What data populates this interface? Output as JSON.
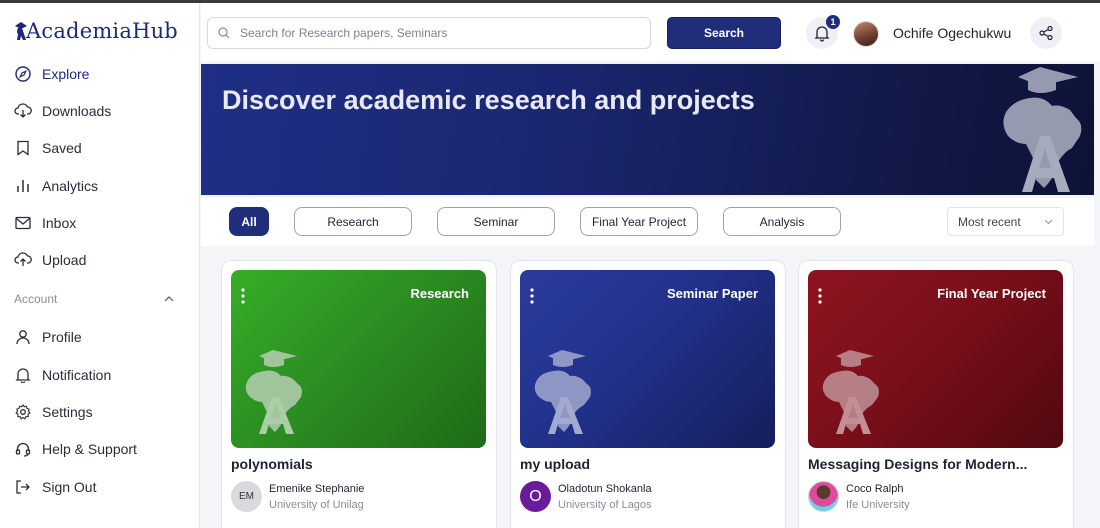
{
  "app": {
    "logo": "AcademiaHub"
  },
  "sidebar": {
    "items": [
      {
        "label": "Explore",
        "icon": "compass-icon"
      },
      {
        "label": "Downloads",
        "icon": "cloud-download-icon"
      },
      {
        "label": "Saved",
        "icon": "bookmark-icon"
      },
      {
        "label": "Analytics",
        "icon": "bar-chart-icon"
      },
      {
        "label": "Inbox",
        "icon": "mail-icon"
      },
      {
        "label": "Upload",
        "icon": "cloud-upload-icon"
      }
    ],
    "section": "Account",
    "account_items": [
      {
        "label": "Profile",
        "icon": "user-icon"
      },
      {
        "label": "Notification",
        "icon": "bell-icon"
      },
      {
        "label": "Settings",
        "icon": "gear-icon"
      },
      {
        "label": "Help & Support",
        "icon": "headset-icon"
      },
      {
        "label": "Sign Out",
        "icon": "sign-out-icon"
      }
    ]
  },
  "header": {
    "search_placeholder": "Search for Research papers, Seminars",
    "search_button": "Search",
    "notification_count": "1",
    "user_name": "Ochife Ogechukwu"
  },
  "hero": {
    "title": "Discover academic research and projects"
  },
  "filters": {
    "chips": [
      "All",
      "Research",
      "Seminar",
      "Final Year Project",
      "Analysis"
    ],
    "sort": "Most recent"
  },
  "cards": [
    {
      "category": "Research",
      "title": "polynomials",
      "author": "Emenike Stephanie",
      "university": "University of Unilag",
      "avatar_text": "EM",
      "color": "#2f9a26"
    },
    {
      "category": "Seminar Paper",
      "title": "my upload",
      "author": "Oladotun Shokanla",
      "university": "University of Lagos",
      "avatar_text": "O",
      "color": "#23338f"
    },
    {
      "category": "Final Year Project",
      "title": "Messaging Designs for Modern...",
      "author": "Coco Ralph",
      "university": "Ife University",
      "avatar_text": "",
      "color": "#7a0f1a"
    }
  ]
}
